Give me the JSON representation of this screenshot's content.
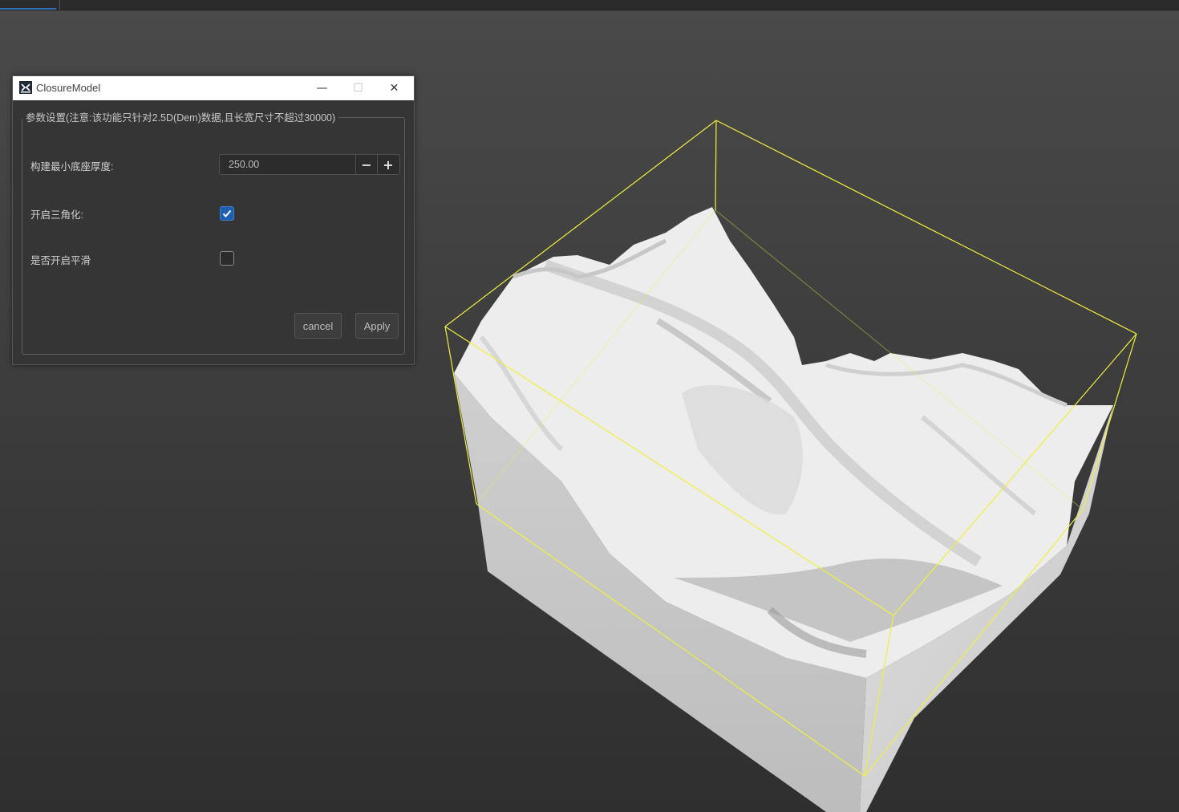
{
  "window": {
    "title": "ClosureModel",
    "minimize_glyph": "—",
    "maximize_glyph": "☐",
    "close_glyph": "✕",
    "icon": "app-logo-icon"
  },
  "group": {
    "title": "参数设置(注意:该功能只针对2.5D(Dem)数据,且长宽尺寸不超过30000)"
  },
  "fields": {
    "min_base_thickness_label": "构建最小底座厚度:",
    "min_base_thickness_value": "250.00",
    "minus_glyph": "−",
    "plus_glyph": "+",
    "triangulate_label": "开启三角化:",
    "triangulate_checked": true,
    "smooth_label": "是否开启平滑",
    "smooth_checked": false
  },
  "buttons": {
    "cancel": "cancel",
    "apply": "Apply"
  },
  "viewport": {
    "bbox_color": "#f0f03c",
    "terrain_color": "#e6e6e6"
  },
  "colors": {
    "accent": "#1f5fb0",
    "dialog_bg": "#353535"
  }
}
